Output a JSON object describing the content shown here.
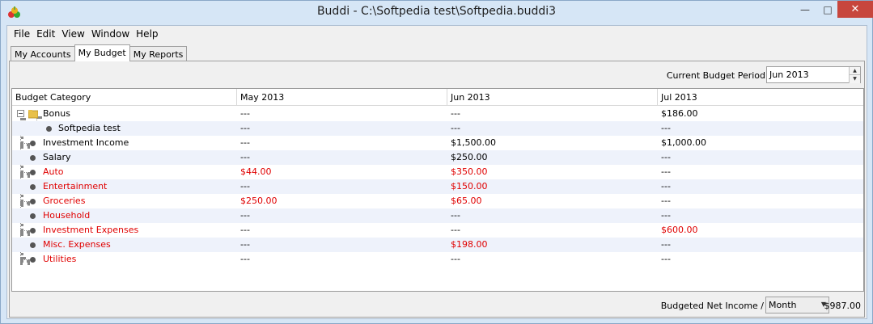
{
  "window": {
    "title": "Buddi - C:\\Softpedia test\\Softpedia.buddi3",
    "minimize_glyph": "—",
    "maximize_glyph": "□",
    "close_glyph": "✕"
  },
  "menu": [
    "File",
    "Edit",
    "View",
    "Window",
    "Help"
  ],
  "tabs": [
    {
      "label": "My Accounts",
      "active": false
    },
    {
      "label": "My Budget",
      "active": true
    },
    {
      "label": "My Reports",
      "active": false
    }
  ],
  "budget": {
    "period_label": "Current Budget Period",
    "period_value": "Jun 2013",
    "columns": [
      "Budget Category",
      "May 2013",
      "Jun 2013",
      "Jul 2013"
    ],
    "rows": [
      {
        "name": "Bonus",
        "level": 0,
        "expandable": true,
        "folder": true,
        "red": false,
        "values": [
          "---",
          "---",
          "$186.00"
        ],
        "red_values": [
          false,
          false,
          false
        ]
      },
      {
        "name": "Softpedia test",
        "level": 1,
        "expandable": false,
        "folder": false,
        "red": false,
        "values": [
          "---",
          "---",
          "---"
        ],
        "red_values": [
          false,
          false,
          false
        ]
      },
      {
        "name": "Investment Income",
        "level": 0,
        "expandable": false,
        "folder": false,
        "red": false,
        "values": [
          "---",
          "$1,500.00",
          "$1,000.00"
        ],
        "red_values": [
          false,
          false,
          false
        ]
      },
      {
        "name": "Salary",
        "level": 0,
        "expandable": false,
        "folder": false,
        "red": false,
        "values": [
          "---",
          "$250.00",
          "---"
        ],
        "red_values": [
          false,
          false,
          false
        ]
      },
      {
        "name": "Auto",
        "level": 0,
        "expandable": false,
        "folder": false,
        "red": true,
        "values": [
          "$44.00",
          "$350.00",
          "---"
        ],
        "red_values": [
          true,
          true,
          false
        ]
      },
      {
        "name": "Entertainment",
        "level": 0,
        "expandable": false,
        "folder": false,
        "red": true,
        "values": [
          "---",
          "$150.00",
          "---"
        ],
        "red_values": [
          false,
          true,
          false
        ]
      },
      {
        "name": "Groceries",
        "level": 0,
        "expandable": false,
        "folder": false,
        "red": true,
        "values": [
          "$250.00",
          "$65.00",
          "---"
        ],
        "red_values": [
          true,
          true,
          false
        ]
      },
      {
        "name": "Household",
        "level": 0,
        "expandable": false,
        "folder": false,
        "red": true,
        "values": [
          "---",
          "---",
          "---"
        ],
        "red_values": [
          false,
          false,
          false
        ]
      },
      {
        "name": "Investment Expenses",
        "level": 0,
        "expandable": false,
        "folder": false,
        "red": true,
        "values": [
          "---",
          "---",
          "$600.00"
        ],
        "red_values": [
          false,
          false,
          true
        ]
      },
      {
        "name": "Misc. Expenses",
        "level": 0,
        "expandable": false,
        "folder": false,
        "red": true,
        "values": [
          "---",
          "$198.00",
          "---"
        ],
        "red_values": [
          false,
          true,
          false
        ]
      },
      {
        "name": "Utilities",
        "level": 0,
        "expandable": false,
        "folder": false,
        "red": true,
        "values": [
          "---",
          "---",
          "---"
        ],
        "red_values": [
          false,
          false,
          false
        ]
      }
    ],
    "footer_label": "Budgeted Net Income /",
    "footer_select": "Month",
    "footer_total": "$987.00"
  },
  "colors": {
    "expense_red": "#e00000",
    "row_alt": "#eef2fb",
    "close_button": "#c7463d"
  }
}
